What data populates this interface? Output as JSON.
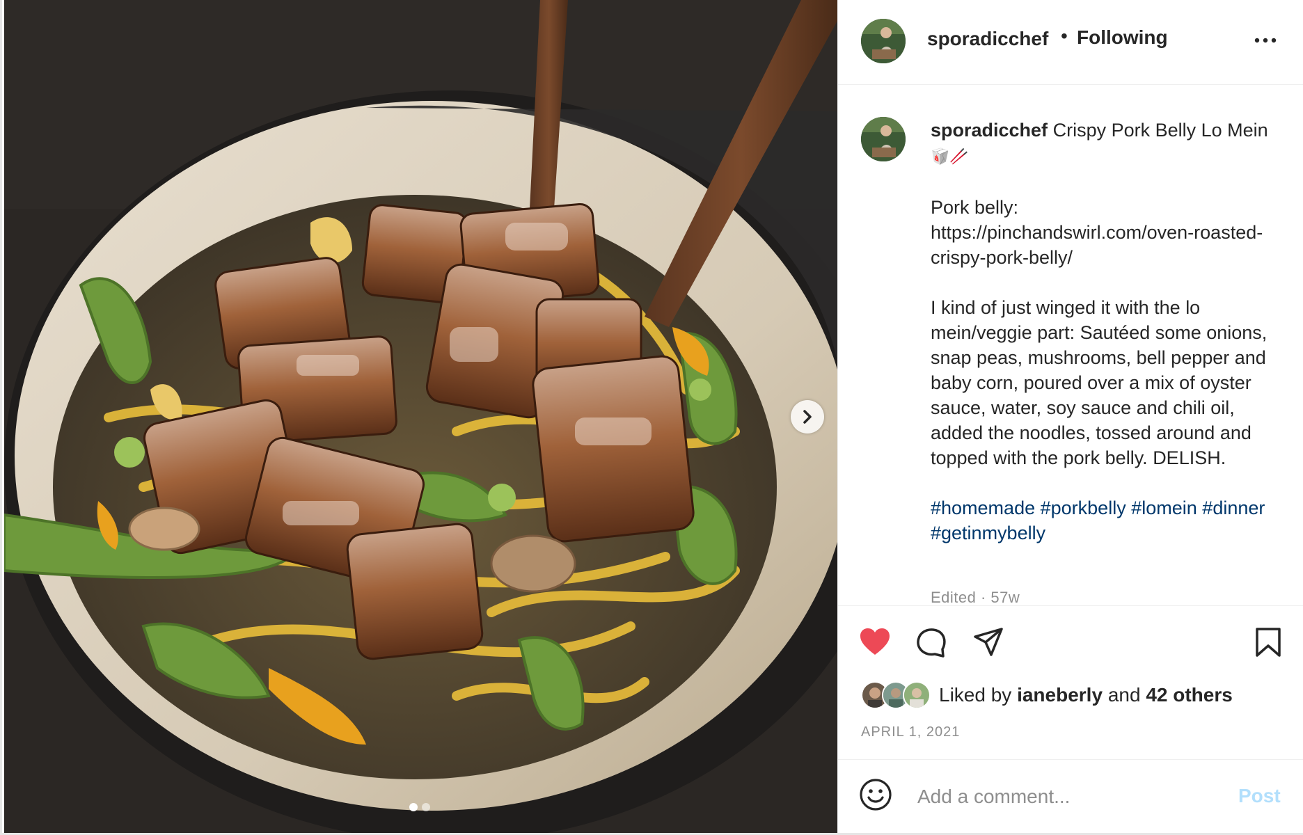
{
  "post": {
    "username": "sporadicchef",
    "separator": "•",
    "follow_status": "Following",
    "caption": {
      "title": "Crispy Pork Belly Lo Mein",
      "title_emoji": "🥡🥢",
      "link_label": "Pork belly:",
      "link_url": "https://pinchandswirl.com/oven-roasted-crispy-pork-belly/",
      "body": "I kind of just winged it with the lo mein/veggie part: Sautéed some onions, snap peas, mushrooms, bell pepper and baby corn, poured over a mix of oyster sauce, water, soy sauce and chili oil, added the noodles, tossed around and topped with the pork belly. DELISH.",
      "hashtags": [
        "#homemade",
        "#porkbelly",
        "#lomein",
        "#dinner",
        "#getinmybelly"
      ]
    },
    "edited_label": "Edited · 57w",
    "likes": {
      "prefix": "Liked by",
      "first_user": "ianeberly",
      "joiner": "and",
      "others": "42 others"
    },
    "date": "APRIL 1, 2021",
    "carousel": {
      "current": 1,
      "total": 2
    },
    "liked": true
  },
  "comment_box": {
    "placeholder": "Add a comment...",
    "post_label": "Post"
  },
  "colors": {
    "like_red": "#ed4956",
    "hashtag_blue": "#00376b",
    "post_disabled": "#b2dffc",
    "muted": "#8e8e8e"
  },
  "icons": {
    "like": "heart-icon",
    "comment": "comment-bubble-icon",
    "share": "paper-plane-icon",
    "save": "bookmark-icon",
    "more": "more-horizontal-icon",
    "next": "chevron-right-icon",
    "emoji": "smiley-icon"
  }
}
